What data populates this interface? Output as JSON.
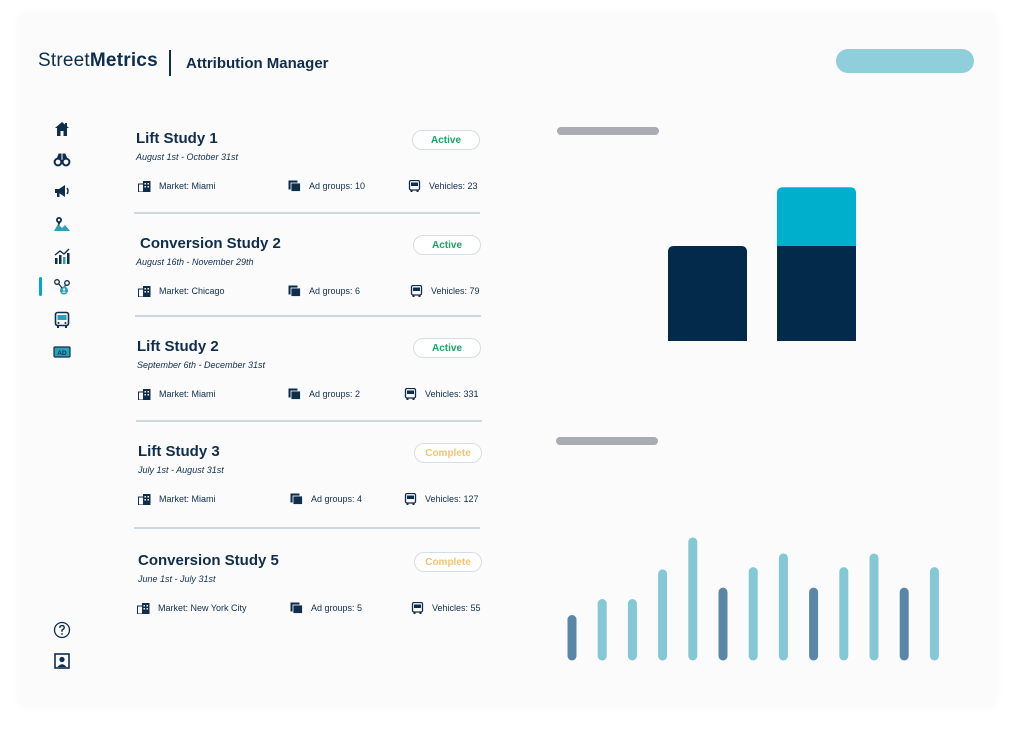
{
  "header": {
    "logo_light": "Street",
    "logo_bold": "Metrics",
    "app_title": "Attribution Manager"
  },
  "sidebar": {
    "items": [
      {
        "icon": "home-icon",
        "active": false
      },
      {
        "icon": "binoculars-icon",
        "active": false
      },
      {
        "icon": "megaphone-icon",
        "active": false
      },
      {
        "icon": "map-icon",
        "active": false
      },
      {
        "icon": "chart-icon",
        "active": false
      },
      {
        "icon": "attribution-icon",
        "active": true
      },
      {
        "icon": "bus-icon",
        "active": false
      },
      {
        "icon": "ad-icon",
        "active": false
      }
    ],
    "bottom": [
      {
        "icon": "help-icon"
      },
      {
        "icon": "profile-icon"
      }
    ]
  },
  "studies": [
    {
      "title": "Lift Study 1",
      "dates": "August 1st - October 31st",
      "status": "Active",
      "market": "Market: Miami",
      "ad_groups": "Ad groups: 10",
      "vehicles": "Vehicles: 23"
    },
    {
      "title": "Conversion Study 2",
      "dates": "August 16th - November 29th",
      "status": "Active",
      "market": "Market: Chicago",
      "ad_groups": "Ad groups: 6",
      "vehicles": "Vehicles: 79"
    },
    {
      "title": "Lift Study 2",
      "dates": "September 6th - December 31st",
      "status": "Active",
      "market": "Market: Miami",
      "ad_groups": "Ad groups: 2",
      "vehicles": "Vehicles: 331"
    },
    {
      "title": "Lift Study 3",
      "dates": "July 1st - August 31st",
      "status": "Complete",
      "market": "Market: Miami",
      "ad_groups": "Ad groups: 4",
      "vehicles": "Vehicles: 127"
    },
    {
      "title": "Conversion Study 5",
      "dates": "June 1st - July 31st",
      "status": "Complete",
      "market": "Market: New York City",
      "ad_groups": "Ad groups: 5",
      "vehicles": "Vehicles: 55"
    }
  ],
  "colors": {
    "navy": "#0f2d4d",
    "dark_bar": "#032a4a",
    "cyan": "#00afcb",
    "light_teal": "#84c8d6",
    "mid_blue": "#5a87a8",
    "active_green": "#19a463",
    "complete_amber": "#f2c372"
  },
  "stacked_chart": {
    "bars": [
      {
        "base": 1.0,
        "top": 0
      },
      {
        "base": 1.0,
        "top": 0.6
      }
    ]
  },
  "line_chart": {
    "values": [
      0.32,
      0.46,
      0.46,
      0.72,
      1.0,
      0.56,
      0.74,
      0.86,
      0.56,
      0.74,
      0.86,
      0.56,
      0.74
    ],
    "shades": [
      "mid",
      "light",
      "light",
      "light",
      "light",
      "mid",
      "light",
      "light",
      "mid",
      "light",
      "light",
      "mid",
      "light"
    ]
  }
}
